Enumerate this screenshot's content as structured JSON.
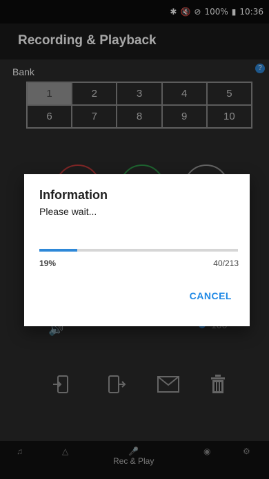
{
  "status_bar": {
    "battery": "100%",
    "time": "10:36"
  },
  "app_title": "Recording & Playback",
  "bank": {
    "label": "Bank",
    "buttons": [
      "1",
      "2",
      "3",
      "4",
      "5",
      "6",
      "7",
      "8",
      "9",
      "10"
    ],
    "selected": "1"
  },
  "circles": [
    {
      "color": "#c43b3b"
    },
    {
      "color": "#2f9a4b"
    },
    {
      "color": "#9a9a9a"
    }
  ],
  "volume": {
    "value": "100"
  },
  "dialog": {
    "title": "Information",
    "message": "Please wait...",
    "progress_fraction": 0.19,
    "percent": "19%",
    "count": "40/213",
    "cancel": "CANCEL"
  },
  "bottom_nav": {
    "rec_play": "Rec & Play"
  },
  "icons": {
    "bluetooth": "bluetooth-icon",
    "mute": "mute-icon",
    "dnd": "do-not-disturb-icon",
    "battery": "battery-icon"
  }
}
